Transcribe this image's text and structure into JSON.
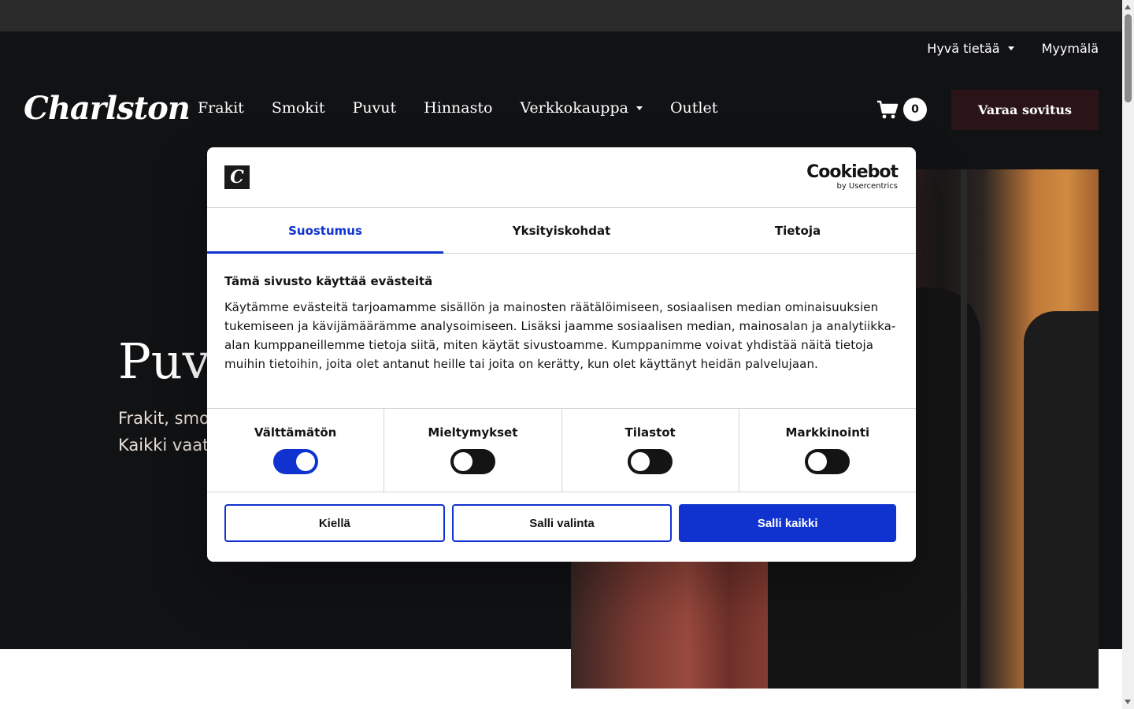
{
  "topbar": {
    "good_to_know": "Hyvä tietää",
    "store": "Myymälä"
  },
  "header": {
    "logo": "Charlston",
    "nav": [
      "Frakit",
      "Smokit",
      "Puvut",
      "Hinnasto",
      "Verkkokauppa",
      "Outlet"
    ],
    "cart_count": "0",
    "book_button": "Varaa sovitus"
  },
  "hero": {
    "title": "Puvu",
    "subtitle_line1": "Frakit, smo",
    "subtitle_line2": "Kaikki vaat"
  },
  "cookie_dialog": {
    "logo_letter": "C",
    "brand_name": "Cookiebot",
    "brand_by": "by Usercentrics",
    "tabs": [
      {
        "label": "Suostumus",
        "active": true
      },
      {
        "label": "Yksityiskohdat",
        "active": false
      },
      {
        "label": "Tietoja",
        "active": false
      }
    ],
    "title": "Tämä sivusto käyttää evästeitä",
    "text": "Käytämme evästeitä tarjoamamme sisällön ja mainosten räätälöimiseen, sosiaalisen median ominaisuuksien tukemiseen ja kävijämäärämme analysoimiseen. Lisäksi jaamme sosiaalisen median, mainosalan ja analytiikka-alan kumppaneillemme tietoja siitä, miten käytät sivustoamme. Kumppanimme voivat yhdistää näitä tietoja muihin tietoihin, joita olet antanut heille tai joita on kerätty, kun olet käyttänyt heidän palvelujaan.",
    "toggles": [
      {
        "label": "Välttämätön",
        "on": true
      },
      {
        "label": "Mieltymykset",
        "on": false
      },
      {
        "label": "Tilastot",
        "on": false
      },
      {
        "label": "Markkinointi",
        "on": false
      }
    ],
    "buttons": {
      "deny": "Kiellä",
      "allow_selection": "Salli valinta",
      "allow_all": "Salli kaikki"
    }
  },
  "colors": {
    "accent": "#1032cf",
    "dark_bg": "#111214",
    "book_button_bg": "#2a1418"
  }
}
